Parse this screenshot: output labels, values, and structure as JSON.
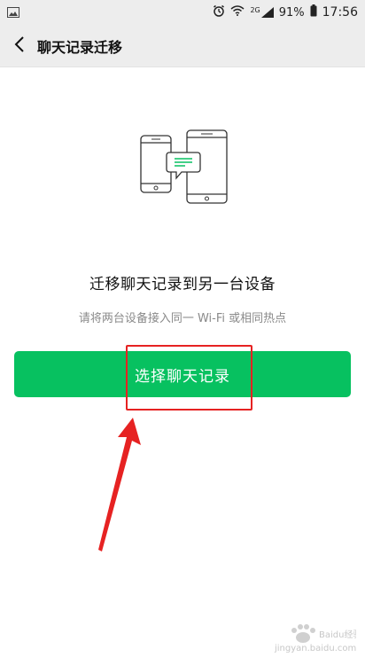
{
  "status_bar": {
    "battery_percent": "91%",
    "time": "17:56",
    "network_type": "2G"
  },
  "nav": {
    "title": "聊天记录迁移"
  },
  "main": {
    "headline": "迁移聊天记录到另一台设备",
    "subtext": "请将两台设备接入同一 Wi-Fi 或相同热点",
    "primary_button_label": "选择聊天记录"
  },
  "watermark": {
    "brand": "Baidu经验",
    "url": "jingyan.baidu.com"
  },
  "colors": {
    "accent_green": "#07c160",
    "annotation_red": "#e62222"
  }
}
